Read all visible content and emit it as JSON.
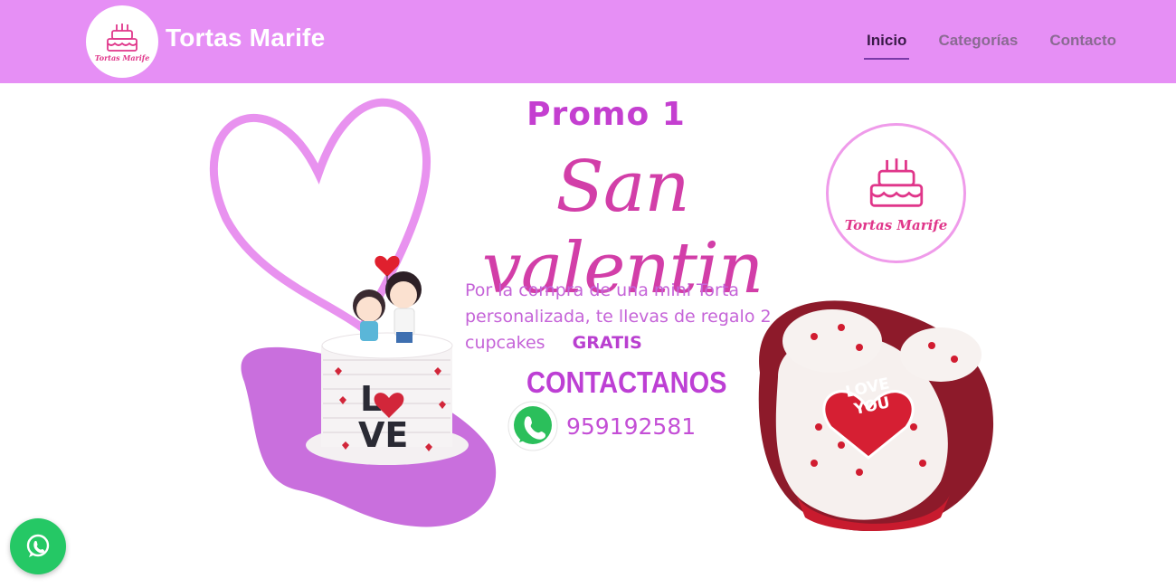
{
  "header": {
    "logo_text": "Tortas Marife",
    "brand": "Tortas Marife",
    "nav": [
      {
        "label": "Inicio",
        "active": true
      },
      {
        "label": "Categorías",
        "active": false
      },
      {
        "label": "Contacto",
        "active": false
      }
    ],
    "background_color": "#e68ff5"
  },
  "banner": {
    "promo_title": "Promo 1",
    "script_title": "San valentin",
    "description": "Por la compra de una mini Torta personalizada, te llevas de regalo 2 cupcakes",
    "gratis": "GRATIS",
    "contact_label": "CONTACTANOS",
    "phone": "959192581",
    "logo_text": "Tortas Marife",
    "cake_text": "LOVE",
    "cupcake_text": "LOVE YOU",
    "accent_color": "#c43fd0"
  },
  "floating_button": {
    "icon": "whatsapp-icon",
    "color": "#25c865"
  }
}
